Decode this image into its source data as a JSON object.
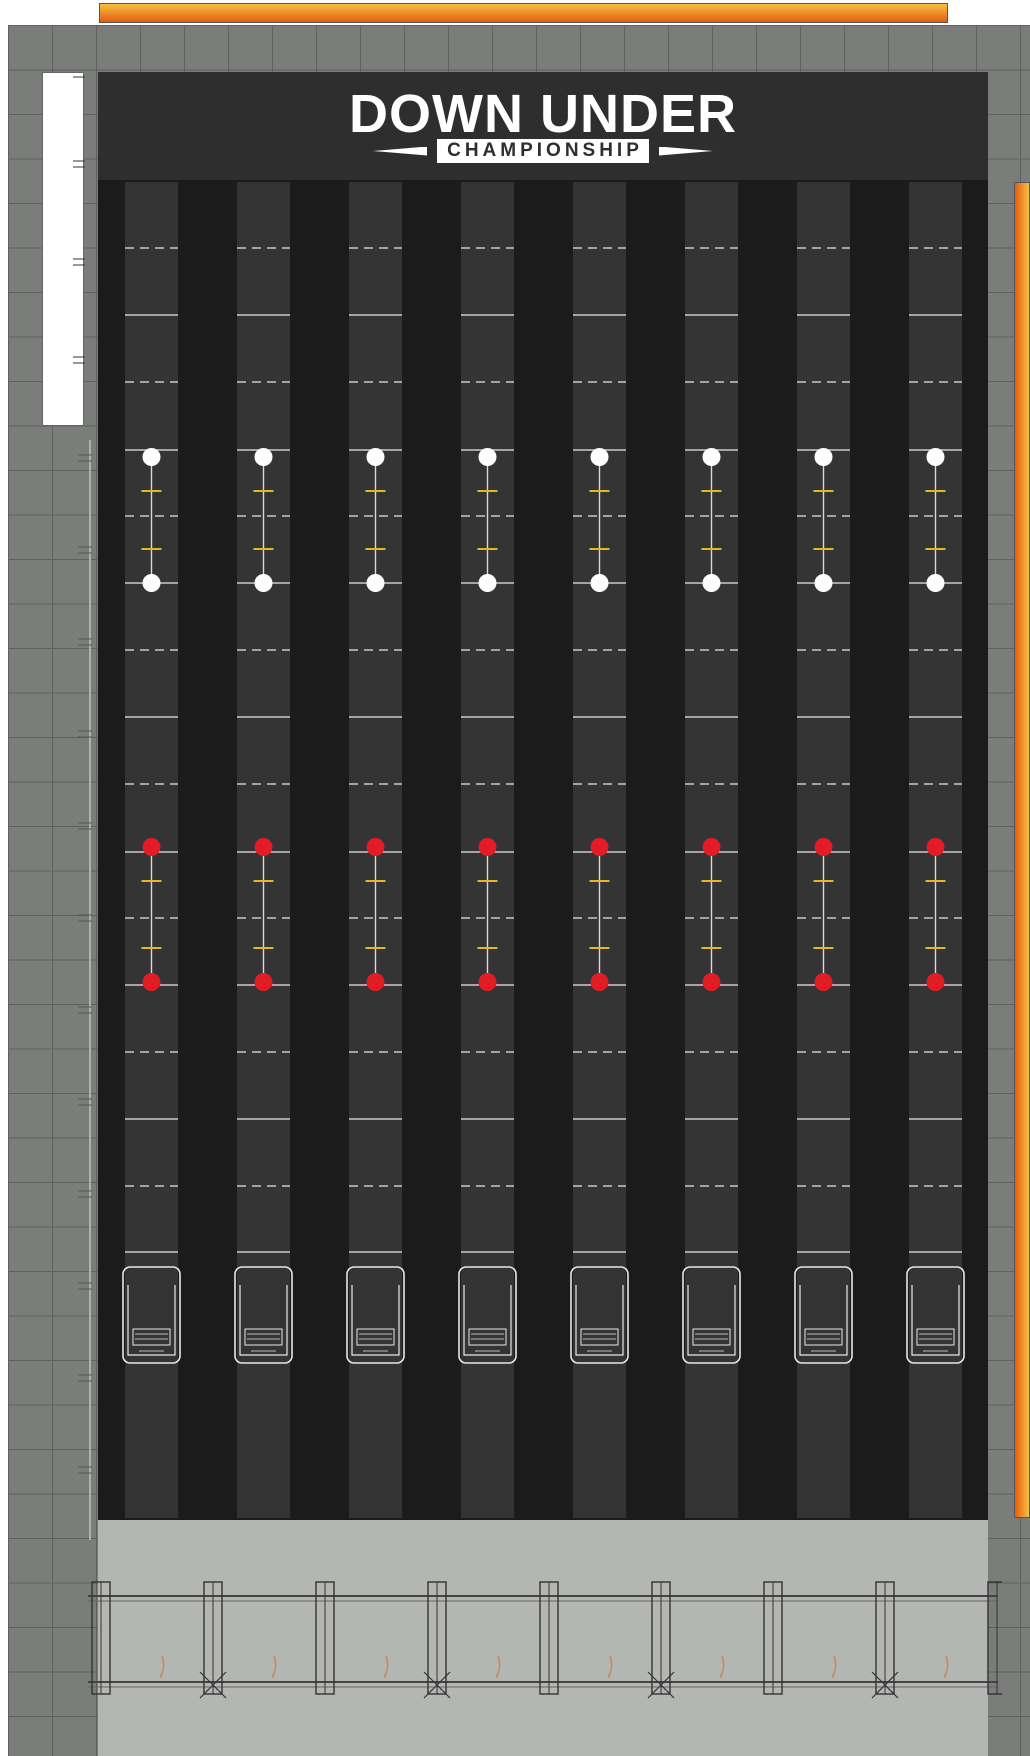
{
  "logo": {
    "title": "DOWN UNDER",
    "subtitle": "CHAMPIONSHIP"
  },
  "colors": {
    "tile": "#7b7d7b",
    "arena": "#1b1b1b",
    "lane": "#333433",
    "header": "#2d2e2d",
    "white_target": "#ffffff",
    "red_target": "#e21b24",
    "cross_mark": "#e8b620",
    "banner_orange": "#e65c10",
    "banner_yellow": "#f8c040",
    "floor": "#b4b6b3"
  },
  "lanes": {
    "count": 8,
    "white_targets_per_lane": 2,
    "red_targets_per_lane": 2
  },
  "barriers": {
    "post_count": 9
  }
}
